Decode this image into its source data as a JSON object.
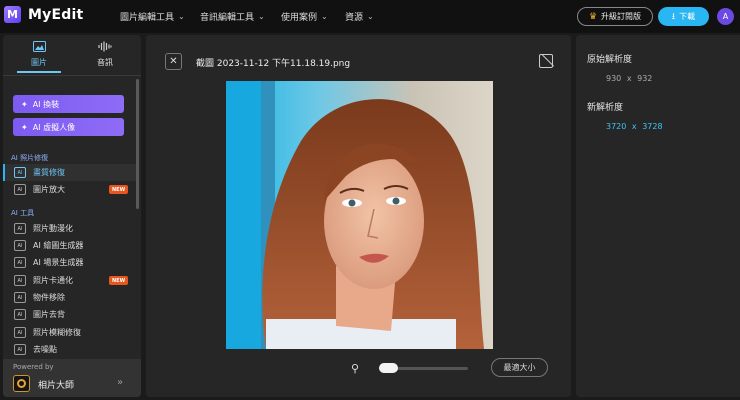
{
  "app": {
    "name": "MyEdit",
    "logo_letter": "M"
  },
  "nav": [
    {
      "label": "圖片編輯工具"
    },
    {
      "label": "音訊編輯工具"
    },
    {
      "label": "使用案例"
    },
    {
      "label": "資源"
    }
  ],
  "header": {
    "upgrade_label": "升級訂閱版",
    "download_label": "下載",
    "avatar_letter": "A"
  },
  "sidebar": {
    "tabs": [
      {
        "label": "圖片",
        "icon": "image-icon",
        "active": true
      },
      {
        "label": "音訊",
        "icon": "waveform-icon",
        "active": false
      }
    ],
    "ai_buttons": [
      {
        "label": "AI 換裝"
      },
      {
        "label": "AI 虛擬人像"
      }
    ],
    "sections": [
      {
        "title": "AI 照片修復",
        "items": [
          {
            "label": "畫質修復",
            "active": true,
            "badge": ""
          },
          {
            "label": "圖片放大",
            "active": false,
            "badge": "NEW"
          }
        ]
      },
      {
        "title": "AI 工具",
        "items": [
          {
            "label": "照片動漫化",
            "badge": ""
          },
          {
            "label": "AI 繪圖生成器",
            "badge": ""
          },
          {
            "label": "AI 場景生成器",
            "badge": ""
          },
          {
            "label": "照片卡通化",
            "badge": "NEW"
          },
          {
            "label": "物件移除",
            "badge": ""
          },
          {
            "label": "圖片去背",
            "badge": ""
          },
          {
            "label": "照片模糊修復",
            "badge": ""
          },
          {
            "label": "去噪點",
            "badge": ""
          }
        ]
      }
    ],
    "powered_by": {
      "label": "Powered by",
      "name": "相片大師"
    }
  },
  "editor": {
    "file_name": "截圖 2023-11-12 下午11.18.19.png",
    "fit_label": "最適大小",
    "zoom_level": 0.0
  },
  "info": {
    "original_label": "原始解析度",
    "original_width": "930",
    "original_height": "932",
    "new_label": "新解析度",
    "new_width": "3720",
    "new_height": "3728",
    "times": "x"
  },
  "colors": {
    "accent": "#2ab6f3",
    "purple": "#7d5bf2",
    "new_badge": "#e8561f",
    "highlight": "#3cc4f5"
  }
}
